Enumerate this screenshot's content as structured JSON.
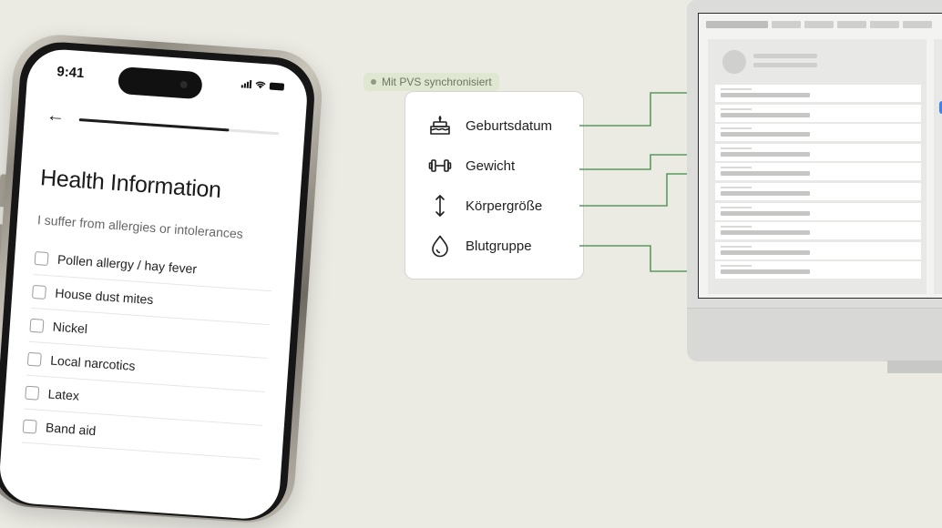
{
  "phone": {
    "status_time": "9:41",
    "progress_fraction": 0.75,
    "title": "Health Information",
    "subtitle": "I suffer from allergies or intolerances",
    "options": [
      "Pollen allergy / hay fever",
      "House dust mites",
      "Nickel",
      "Local narcotics",
      "Latex",
      "Band aid"
    ]
  },
  "sync_badge": "Mit PVS synchronisiert",
  "fields": [
    {
      "label": "Geburtsdatum",
      "icon": "birthday-cake-icon"
    },
    {
      "label": "Gewicht",
      "icon": "dumbbell-icon"
    },
    {
      "label": "Körpergröße",
      "icon": "height-arrow-icon"
    },
    {
      "label": "Blutgruppe",
      "icon": "blood-drop-icon"
    }
  ],
  "colors": {
    "background": "#ebeae3",
    "connector": "#5a9a5e",
    "badge_bg": "#dfe6d1",
    "accent": "#3b82f6"
  }
}
